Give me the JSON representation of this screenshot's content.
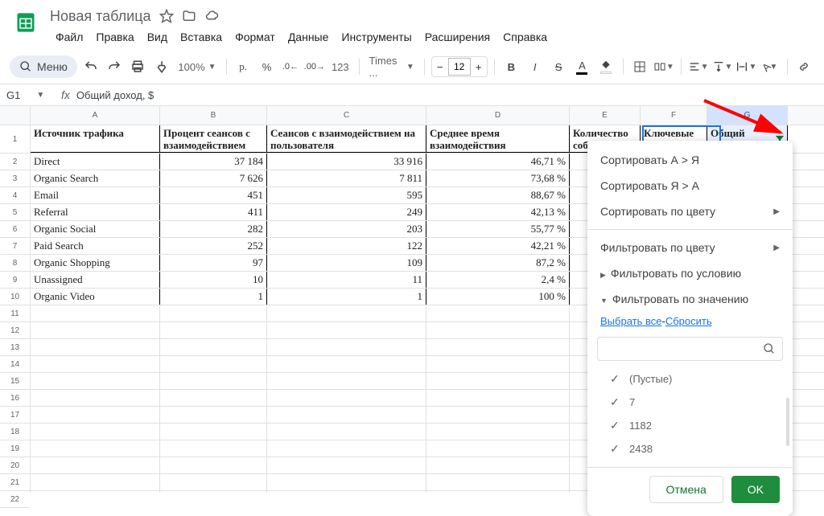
{
  "doc_title": "Новая таблица",
  "menubar": [
    "Файл",
    "Правка",
    "Вид",
    "Вставка",
    "Формат",
    "Данные",
    "Инструменты",
    "Расширения",
    "Справка"
  ],
  "menu_label": "Меню",
  "zoom": "100%",
  "font": "Times ...",
  "font_size": "12",
  "cell_ref": "G1",
  "formula": "Общий доход, $",
  "cols": [
    "A",
    "B",
    "C",
    "D",
    "E",
    "F",
    "G"
  ],
  "headers": {
    "A": "Источник трафика",
    "B": "Процент сеансов с взаимодействием",
    "C": "Сеансов с взаимодействием на пользователя",
    "D": "Среднее время взаимодействия",
    "E": "Количество соб",
    "F": "Ключевые",
    "G": "Общий"
  },
  "rows": [
    {
      "A": "Direct",
      "B": "37 184",
      "C": "33 916",
      "D": "46,71 %"
    },
    {
      "A": "Organic Search",
      "B": "7 626",
      "C": "7 811",
      "D": "73,68 %"
    },
    {
      "A": "Email",
      "B": "451",
      "C": "595",
      "D": "88,67 %"
    },
    {
      "A": "Referral",
      "B": "411",
      "C": "249",
      "D": "42,13 %"
    },
    {
      "A": "Organic Social",
      "B": "282",
      "C": "203",
      "D": "55,77 %"
    },
    {
      "A": "Paid Search",
      "B": "252",
      "C": "122",
      "D": "42,21 %"
    },
    {
      "A": "Organic Shopping",
      "B": "97",
      "C": "109",
      "D": "87,2 %"
    },
    {
      "A": "Unassigned",
      "B": "10",
      "C": "11",
      "D": "2,4 %"
    },
    {
      "A": "Organic Video",
      "B": "1",
      "C": "1",
      "D": "100 %"
    }
  ],
  "filter": {
    "sort_az": "Сортировать А > Я",
    "sort_za": "Сортировать Я > А",
    "sort_color": "Сортировать по цвету",
    "filter_color": "Фильтровать по цвету",
    "filter_cond": "Фильтровать по условию",
    "filter_val": "Фильтровать по значению",
    "select_all": "Выбрать все",
    "reset": "Сбросить",
    "values": [
      "(Пустые)",
      "7",
      "1182",
      "2438"
    ],
    "cancel": "Отмена",
    "ok": "OK"
  }
}
